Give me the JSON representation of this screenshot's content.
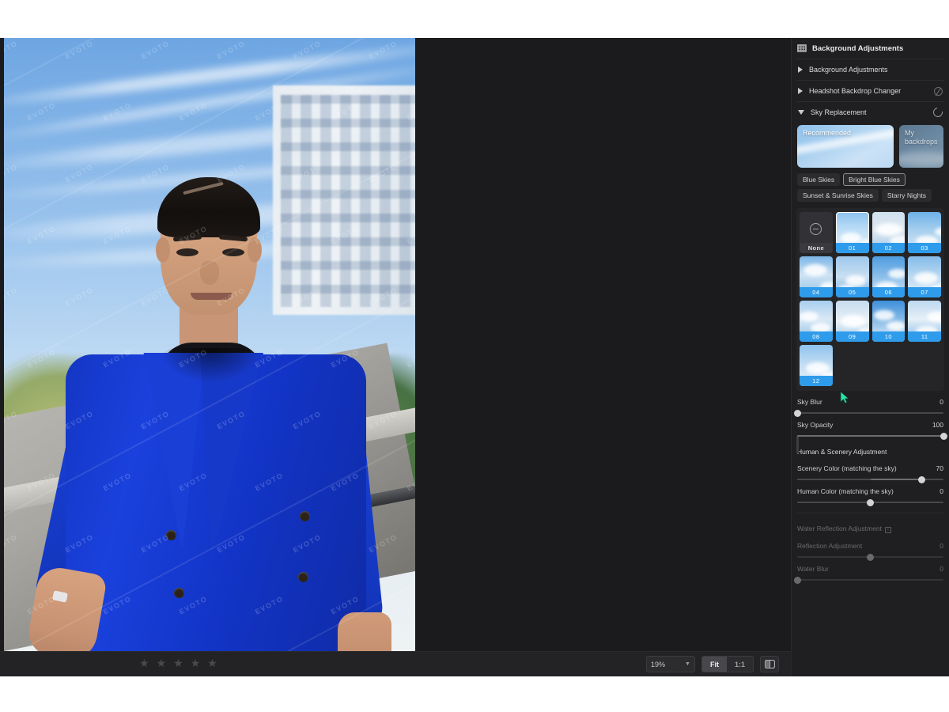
{
  "panel": {
    "header_title": "Background Adjustments",
    "header_icon": "grid-image-icon",
    "sections": [
      {
        "label": "Background Adjustments",
        "expanded": false,
        "right_icon": ""
      },
      {
        "label": "Headshot Backdrop Changer",
        "expanded": false,
        "right_icon": "disabled-circle-icon"
      },
      {
        "label": "Sky Replacement",
        "expanded": true,
        "right_icon": "reset-icon"
      }
    ],
    "backdrop_tabs": [
      {
        "label": "Recommended",
        "selected": true
      },
      {
        "label": "My backdrops",
        "selected": false
      }
    ],
    "category_chips": [
      {
        "label": "Blue Skies",
        "selected": false
      },
      {
        "label": "Bright Blue Skies",
        "selected": true
      },
      {
        "label": "Sunset & Sunrise Skies",
        "selected": false
      },
      {
        "label": "Starry Nights",
        "selected": false
      }
    ],
    "thumbnails": [
      {
        "label": "None",
        "selected": false,
        "kind": "none"
      },
      {
        "label": "01",
        "selected": true,
        "kind": "sky"
      },
      {
        "label": "02",
        "selected": false,
        "kind": "sky"
      },
      {
        "label": "03",
        "selected": false,
        "kind": "sky"
      },
      {
        "label": "04",
        "selected": false,
        "kind": "sky"
      },
      {
        "label": "05",
        "selected": false,
        "kind": "sky"
      },
      {
        "label": "06",
        "selected": false,
        "kind": "sky"
      },
      {
        "label": "07",
        "selected": false,
        "kind": "sky"
      },
      {
        "label": "08",
        "selected": false,
        "kind": "sky"
      },
      {
        "label": "09",
        "selected": false,
        "kind": "sky"
      },
      {
        "label": "10",
        "selected": false,
        "kind": "sky"
      },
      {
        "label": "11",
        "selected": false,
        "kind": "sky"
      },
      {
        "label": "12",
        "selected": false,
        "kind": "sky"
      }
    ],
    "sliders": [
      {
        "name": "Sky Blur",
        "value": "0",
        "pct": 0,
        "bipolar": false,
        "disabled": false
      },
      {
        "name": "Sky Opacity",
        "value": "100",
        "pct": 100,
        "bipolar": false,
        "disabled": false
      }
    ],
    "human_scenery_group": "Human & Scenery Adjustment",
    "human_scenery_sliders": [
      {
        "name": "Scenery Color (matching the sky)",
        "value": "70",
        "pct": 85,
        "bipolar": true,
        "disabled": false
      },
      {
        "name": "Human Color (matching the sky)",
        "value": "0",
        "pct": 50,
        "bipolar": true,
        "disabled": false
      }
    ],
    "water_group": "Water Reflection Adjustment",
    "water_group_icon": "info-icon",
    "water_sliders": [
      {
        "name": "Reflection Adjustment",
        "value": "0",
        "pct": 50,
        "bipolar": true,
        "disabled": true
      },
      {
        "name": "Water Blur",
        "value": "0",
        "pct": 0,
        "bipolar": false,
        "disabled": true
      }
    ]
  },
  "bottombar": {
    "stars": [
      "star",
      "star",
      "star",
      "star",
      "star"
    ],
    "zoom_value": "19%",
    "zoom_chevron": "chevron-down-icon",
    "fit_label": "Fit",
    "one_to_one_label": "1:1",
    "compare_icon": "split-view-icon"
  },
  "viewer": {
    "info_icon": "info-icon",
    "watermark_text": "EVOTO"
  },
  "colors": {
    "accent_blue": "#2f9ceb",
    "panel_bg": "#1f1f21",
    "canvas_bg": "#1b1b1d",
    "cursor": "#2fe5a8"
  }
}
